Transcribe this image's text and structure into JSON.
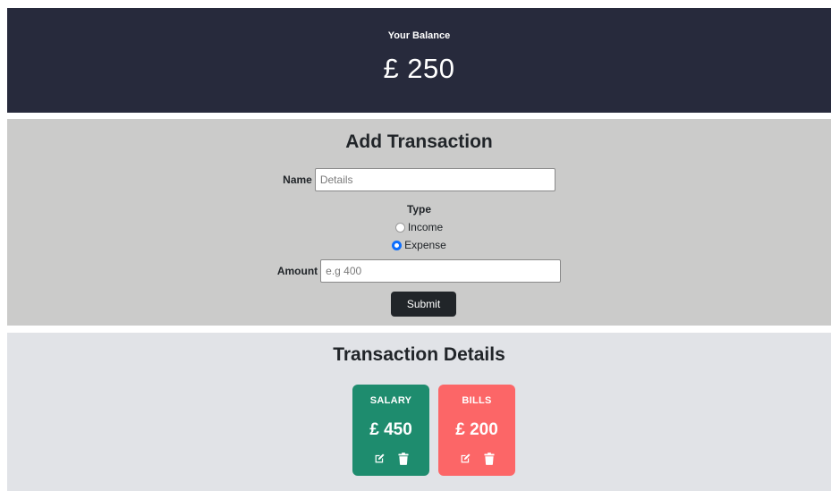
{
  "balance": {
    "label": "Your Balance",
    "value": "£ 250"
  },
  "add_transaction": {
    "title": "Add Transaction",
    "name_label": "Name",
    "name_placeholder": "Details",
    "type_label": "Type",
    "income_label": "Income",
    "expense_label": "Expense",
    "selected_type": "Expense",
    "amount_label": "Amount",
    "amount_placeholder": "e.g 400",
    "submit_label": "Submit"
  },
  "transaction_details": {
    "title": "Transaction Details",
    "cards": [
      {
        "label": "SALARY",
        "amount": "£ 450",
        "color": "#1e8c6e",
        "icons": [
          "edit-icon",
          "trash-icon"
        ]
      },
      {
        "label": "BILLS",
        "amount": "£ 200",
        "color": "#fc6667",
        "icons": [
          "edit-icon",
          "trash-icon"
        ]
      }
    ]
  },
  "colors": {
    "header_bg": "#272a3c",
    "form_bg": "#cbcbca",
    "details_bg": "#e1e3e7",
    "button_bg": "#212529",
    "radio_accent": "#0d6efd"
  }
}
